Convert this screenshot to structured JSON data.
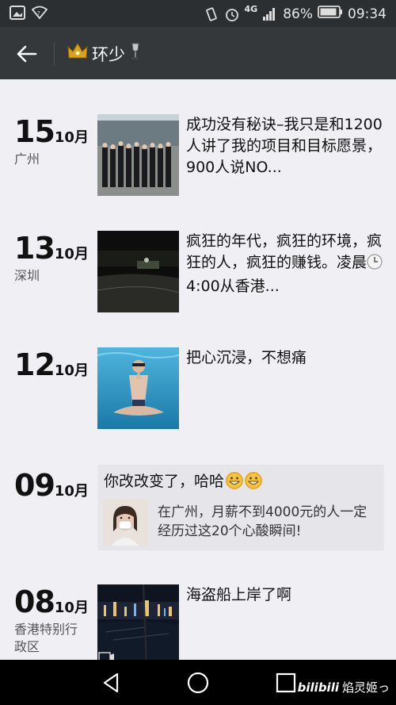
{
  "status_bar": {
    "network": "4G",
    "battery_percent": "86%",
    "time": "09:34"
  },
  "header": {
    "back_icon": "arrow-left-icon",
    "title": "环少"
  },
  "posts": [
    {
      "day": "15",
      "month": "10月",
      "location": "广州",
      "text": "成功没有秘诀–我只是和1200人讲了我的项目和目标愿景，900人说NO..."
    },
    {
      "day": "13",
      "month": "10月",
      "location": "深圳",
      "text_a": "疯狂的年代，疯狂的环境，疯狂的人，疯狂的赚钱。凌晨",
      "text_b": "4:00从香港..."
    },
    {
      "day": "12",
      "month": "10月",
      "location": "",
      "text": "把心沉浸，不想痛"
    },
    {
      "day": "09",
      "month": "10月",
      "location": "",
      "share_text": "你改改变了，哈哈",
      "link_title": "在广州，月薪不到4000元的人一定经历过这20个心酸瞬间!"
    },
    {
      "day": "08",
      "month": "10月",
      "location": "香港特别行政区",
      "text": "海盗船上岸了啊"
    }
  ],
  "nav": {
    "back": "triangle-back-icon",
    "home": "circle-home-icon",
    "recent": "square-recent-icon"
  },
  "watermark": {
    "brand": "bilibili",
    "user": "焰灵姬っ"
  },
  "colors": {
    "status_bg": "#2c2f31",
    "title_bg": "#34383a",
    "content_bg": "#efeff4",
    "share_bg": "#e6e6ea"
  }
}
